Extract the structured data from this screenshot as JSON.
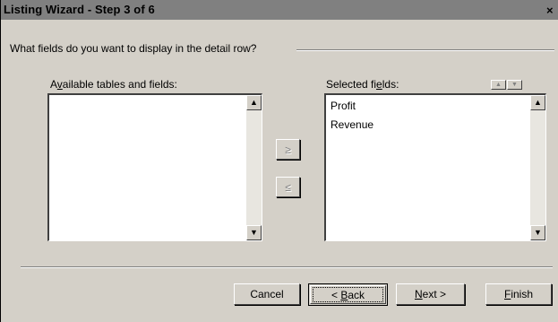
{
  "window": {
    "title": "Listing Wizard - Step 3 of 6",
    "close": "×"
  },
  "prompt": "What fields do you want to display in the detail row?",
  "available": {
    "label": {
      "before": "A",
      "accel": "v",
      "after": "ailable tables and fields:"
    },
    "items": []
  },
  "selected": {
    "label": {
      "before": "Selected fi",
      "accel": "e",
      "after": "lds:"
    },
    "items": [
      "Profit",
      "Revenue"
    ]
  },
  "move": {
    "add": "≥",
    "remove": "≤"
  },
  "order": {
    "up": "▲",
    "down": "▼"
  },
  "scroll": {
    "up": "▲",
    "down": "▼"
  },
  "buttons": {
    "cancel": "Cancel",
    "back": {
      "before": "< ",
      "accel": "B",
      "after": "ack"
    },
    "next": {
      "before": "",
      "accel": "N",
      "after": "ext >"
    },
    "finish": {
      "before": "",
      "accel": "F",
      "after": "inish"
    }
  }
}
